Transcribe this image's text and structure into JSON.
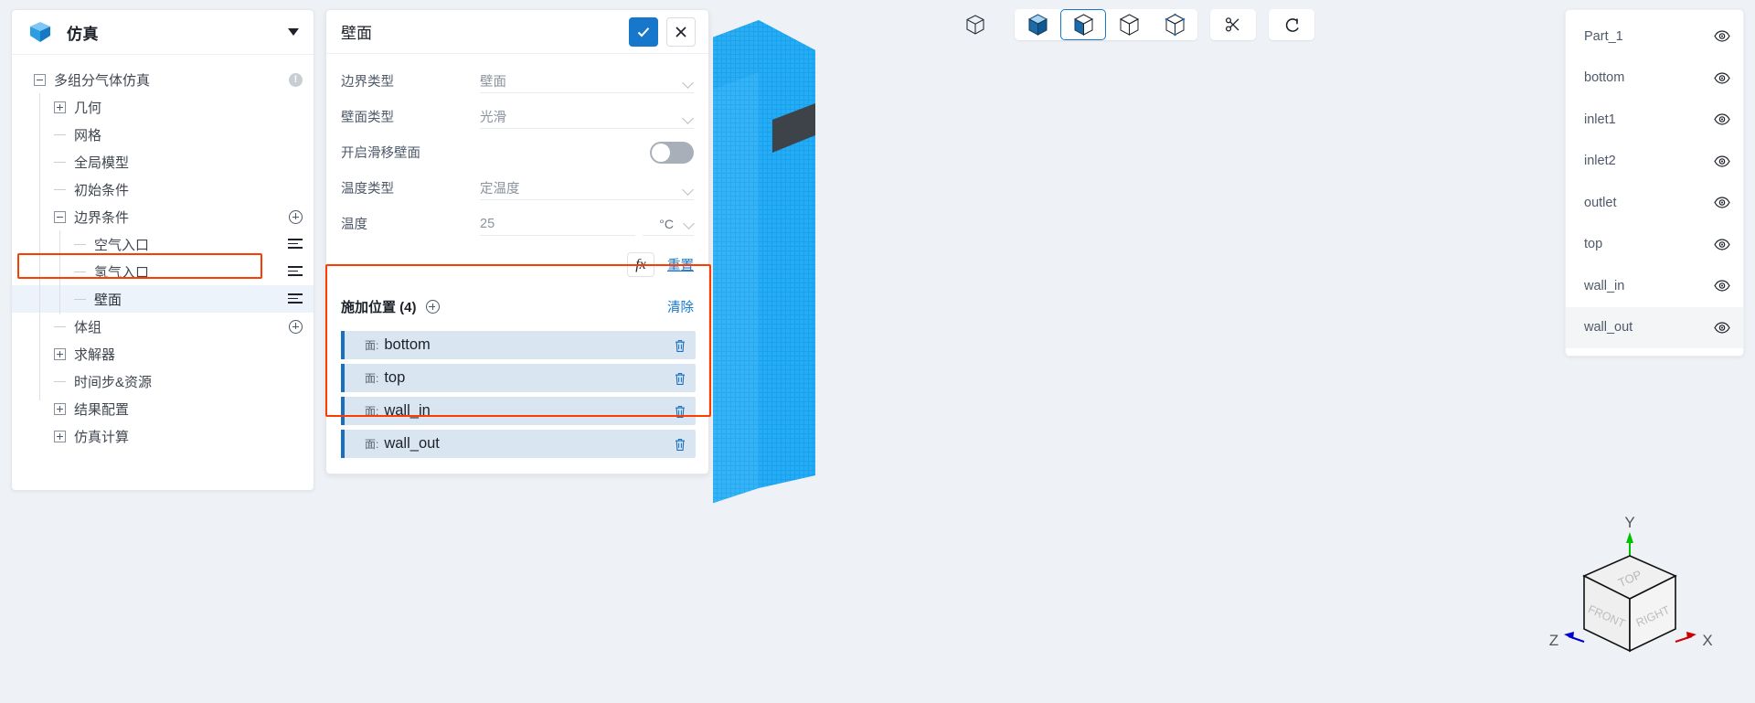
{
  "sidebar": {
    "logo_icon": "cube-logo-icon",
    "title": "仿真",
    "caret_icon": "chevron-down-icon",
    "tree": [
      {
        "label": "多组分气体仿真",
        "toggle": "minus",
        "indent": 0,
        "icon": "info-icon",
        "selected": false
      },
      {
        "label": "几何",
        "toggle": "plus",
        "indent": 1,
        "icon": "",
        "selected": false
      },
      {
        "label": "网格",
        "toggle": "leaf",
        "indent": 1,
        "icon": "",
        "selected": false
      },
      {
        "label": "全局模型",
        "toggle": "leaf",
        "indent": 1,
        "icon": "",
        "selected": false
      },
      {
        "label": "初始条件",
        "toggle": "leaf",
        "indent": 1,
        "icon": "",
        "selected": false
      },
      {
        "label": "边界条件",
        "toggle": "minus",
        "indent": 1,
        "icon": "plus-circle-icon",
        "selected": false
      },
      {
        "label": "空气入口",
        "toggle": "leaf",
        "indent": 2,
        "icon": "list-icon",
        "selected": false
      },
      {
        "label": "氢气入口",
        "toggle": "leaf",
        "indent": 2,
        "icon": "list-icon",
        "selected": false
      },
      {
        "label": "壁面",
        "toggle": "leaf",
        "indent": 2,
        "icon": "list-icon",
        "selected": true
      },
      {
        "label": "体组",
        "toggle": "leaf",
        "indent": 1,
        "icon": "plus-circle-icon",
        "selected": false
      },
      {
        "label": "求解器",
        "toggle": "plus",
        "indent": 1,
        "icon": "",
        "selected": false
      },
      {
        "label": "时间步&资源",
        "toggle": "leaf",
        "indent": 1,
        "icon": "",
        "selected": false
      },
      {
        "label": "结果配置",
        "toggle": "plus",
        "indent": 1,
        "icon": "",
        "selected": false
      },
      {
        "label": "仿真计算",
        "toggle": "plus",
        "indent": 1,
        "icon": "",
        "selected": false
      }
    ]
  },
  "panel": {
    "title": "壁面",
    "confirm_icon": "check-icon",
    "cancel_icon": "close-icon",
    "fields": [
      {
        "label": "边界类型",
        "value": "壁面",
        "type": "select"
      },
      {
        "label": "壁面类型",
        "value": "光滑",
        "type": "select"
      },
      {
        "label": "开启滑移壁面",
        "value": "",
        "type": "toggle",
        "on": false
      },
      {
        "label": "温度类型",
        "value": "定温度",
        "type": "select"
      },
      {
        "label": "温度",
        "value": "25",
        "type": "number",
        "unit": "°C"
      }
    ],
    "fx_label": "fx",
    "reset_label": "重置",
    "positions": {
      "title": "施加位置 (4)",
      "add_icon": "plus-circle-icon",
      "clear_label": "清除",
      "items": [
        {
          "prefix": "面:",
          "name": "bottom",
          "delete_icon": "trash-icon"
        },
        {
          "prefix": "面:",
          "name": "top",
          "delete_icon": "trash-icon"
        },
        {
          "prefix": "面:",
          "name": "wall_in",
          "delete_icon": "trash-icon"
        },
        {
          "prefix": "面:",
          "name": "wall_out",
          "delete_icon": "trash-icon"
        }
      ]
    }
  },
  "toolbar": {
    "items": [
      {
        "name": "explode-cube-icon",
        "style": "standalone",
        "active": false
      },
      {
        "name": "shaded-cube-icon",
        "style": "group",
        "active": false
      },
      {
        "name": "shaded-edges-cube-icon",
        "style": "group",
        "active": true
      },
      {
        "name": "wireframe-cube-icon",
        "style": "group",
        "active": false
      },
      {
        "name": "points-cube-icon",
        "style": "group",
        "active": false
      },
      {
        "name": "scissors-icon",
        "style": "single",
        "active": false
      },
      {
        "name": "reset-rotate-icon",
        "style": "single",
        "active": false
      }
    ]
  },
  "parts": {
    "items": [
      {
        "label": "Part_1",
        "eye_icon": "eye-icon",
        "highlight": false
      },
      {
        "label": "bottom",
        "eye_icon": "eye-icon",
        "highlight": false
      },
      {
        "label": "inlet1",
        "eye_icon": "eye-icon",
        "highlight": false
      },
      {
        "label": "inlet2",
        "eye_icon": "eye-icon",
        "highlight": false
      },
      {
        "label": "outlet",
        "eye_icon": "eye-icon",
        "highlight": false
      },
      {
        "label": "top",
        "eye_icon": "eye-icon",
        "highlight": false
      },
      {
        "label": "wall_in",
        "eye_icon": "eye-icon",
        "highlight": false
      },
      {
        "label": "wall_out",
        "eye_icon": "eye-icon",
        "highlight": true
      }
    ]
  },
  "axis_cube": {
    "faces": [
      "TOP",
      "FRONT",
      "RIGHT"
    ],
    "axes": [
      {
        "label": "Y",
        "color": "#00c000"
      },
      {
        "label": "X",
        "color": "#cc0000"
      },
      {
        "label": "Z",
        "color": "#0000cc"
      }
    ]
  },
  "colors": {
    "accent": "#1677cb",
    "mesh_blue": "#2eaaf0",
    "mesh_dark": "#3e4349",
    "highlight_outline": "#fc3d03",
    "viewport_bg": "#eef1f5"
  }
}
